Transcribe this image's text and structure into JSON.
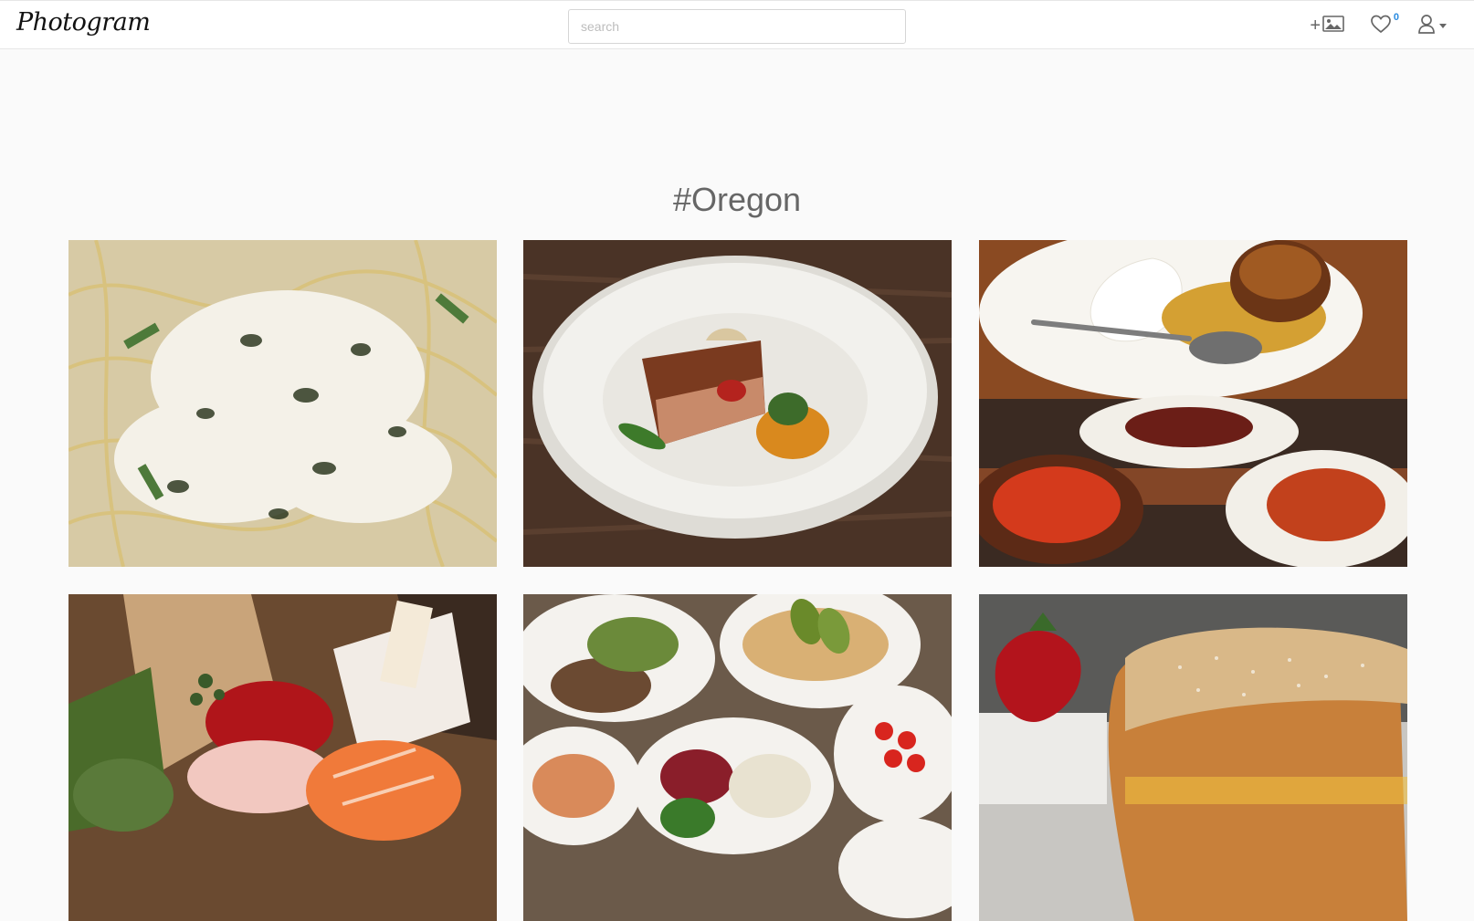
{
  "header": {
    "brand": "Photogram",
    "search_placeholder": "search",
    "likes_count": "0",
    "upload_plus": "+",
    "icons": [
      "add-photo-icon",
      "heart-icon",
      "user-icon"
    ]
  },
  "page": {
    "tag_title": "#Oregon"
  },
  "posts": [
    {
      "subject": "pasta with grated cheese and pistachios"
    },
    {
      "subject": "pork belly with mushrooms on white plate"
    },
    {
      "subject": "dessert plate collage"
    },
    {
      "subject": "sashimi platter with wasabi root"
    },
    {
      "subject": "table of grilled plates and salads"
    },
    {
      "subject": "french toast with strawberries"
    }
  ],
  "colors": {
    "background": "#fafafa",
    "navbar": "#ffffff",
    "badge": "#2a8be0",
    "title": "#666666"
  }
}
